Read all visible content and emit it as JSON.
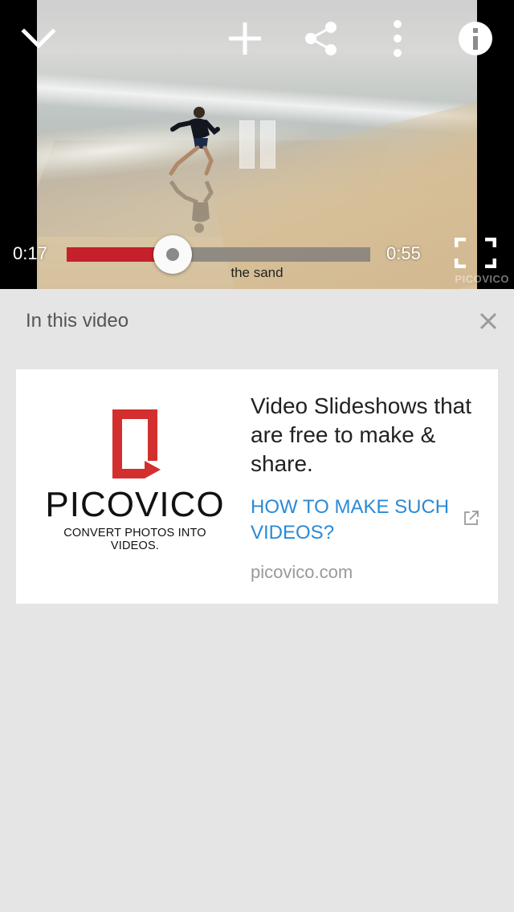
{
  "player": {
    "current_time": "0:17",
    "duration": "0:55",
    "progress_fraction": 0.35,
    "caption": "the sand",
    "watermark": "PICOVICO",
    "icons": [
      "chevron-down-icon",
      "plus-icon",
      "share-icon",
      "more-vertical-icon",
      "info-icon",
      "pause-icon",
      "fullscreen-icon"
    ]
  },
  "panel": {
    "title": "In this video",
    "close_icon": "close-icon"
  },
  "card": {
    "logo_name": "PICOVICO",
    "logo_tagline": "CONVERT PHOTOS INTO VIDEOS.",
    "title": "Video Slideshows that are free to make & share.",
    "link_label": "HOW TO MAKE SUCH VIDEOS?",
    "domain": "picovico.com",
    "brand_color": "#d32f2f",
    "link_color": "#2a8ad6"
  }
}
